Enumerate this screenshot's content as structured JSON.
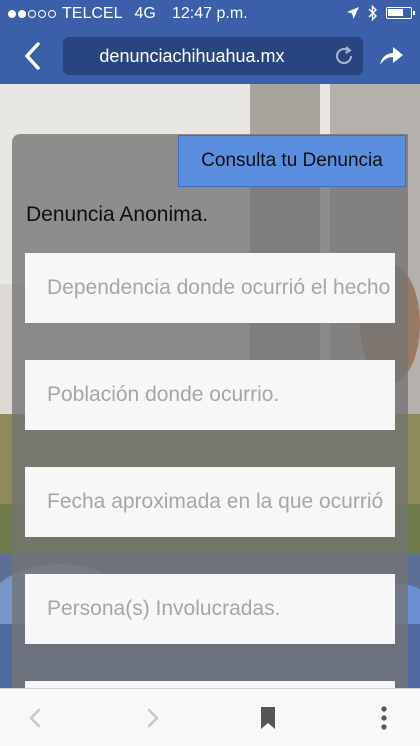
{
  "status_bar": {
    "carrier": "TELCEL",
    "network": "4G",
    "time": "12:47 p.m."
  },
  "browser": {
    "url": "denunciachihuahua.mx"
  },
  "page": {
    "consulta_button": "Consulta tu Denuncia",
    "form_title": "Denuncia Anonima.",
    "fields": [
      {
        "placeholder": "Dependencia donde ocurrió el hecho"
      },
      {
        "placeholder": "Población donde ocurrio."
      },
      {
        "placeholder": "Fecha aproximada en la que ocurrió"
      },
      {
        "placeholder": "Persona(s) Involucradas."
      },
      {
        "placeholder": ""
      }
    ]
  },
  "colors": {
    "browser_chrome": "#3b5fa8",
    "url_field": "#29457f",
    "consulta_button": "#5c8ee0"
  }
}
